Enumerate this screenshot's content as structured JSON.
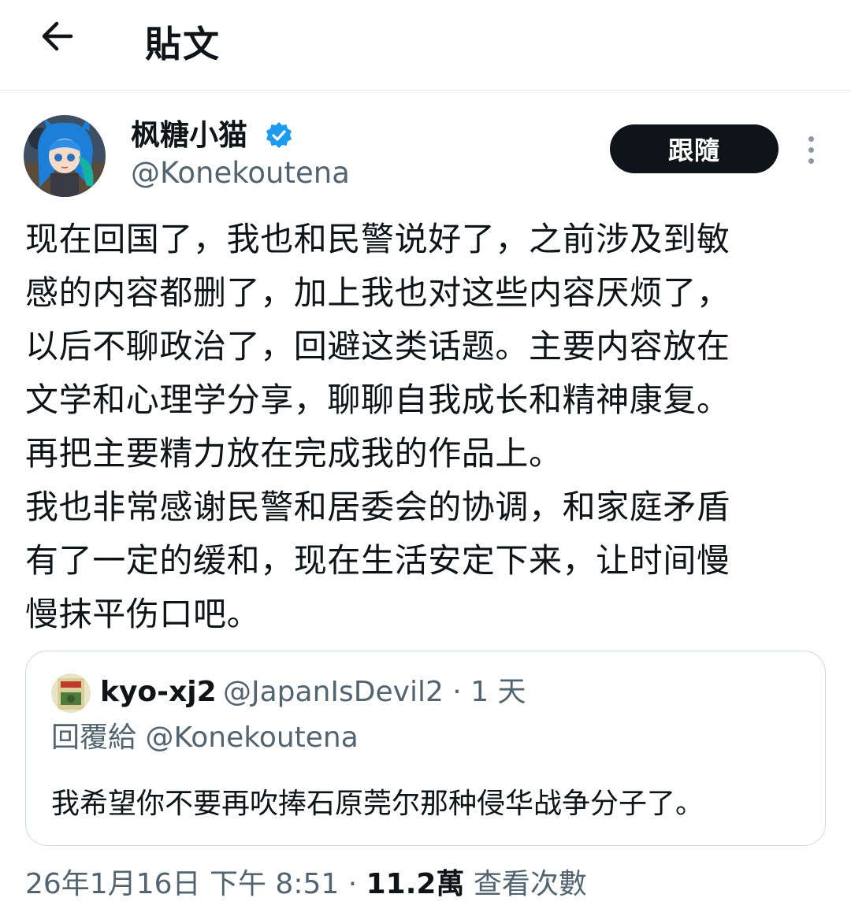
{
  "header": {
    "title": "貼文",
    "back_icon": "arrow-left-icon"
  },
  "author": {
    "display_name": "枫糖小猫",
    "handle": "@Konekoutena",
    "verified_icon": "verified-badge-icon",
    "verified_color": "#1d9bf0",
    "follow_label": "跟隨",
    "more_icon": "more-vertical-icon"
  },
  "post": {
    "lines": [
      "现在回国了，我也和民警说好了，之前涉及到敏",
      "感的内容都删了，加上我也对这些内容厌烦了，",
      "以后不聊政治了，回避这类话题。主要内容放在",
      "文学和心理学分享，聊聊自我成长和精神康复。",
      "再把主要精力放在完成我的作品上。",
      "我也非常感谢民警和居委会的协调，和家庭矛盾",
      "有了一定的缓和，现在生活安定下来，让时间慢",
      "慢抹平伤口吧。"
    ]
  },
  "quote": {
    "name": "kyo-xj2",
    "handle_time": "@JapanIsDevil2 · 1 天",
    "reply_to": "回覆給 @Konekoutena",
    "text": "我希望你不要再吹捧石原莞尔那种侵华战争分子了。"
  },
  "meta": {
    "timestamp": "26年1月16日 下午 8:51 · ",
    "views_count": "11.2萬",
    "views_label": " 查看次數"
  }
}
